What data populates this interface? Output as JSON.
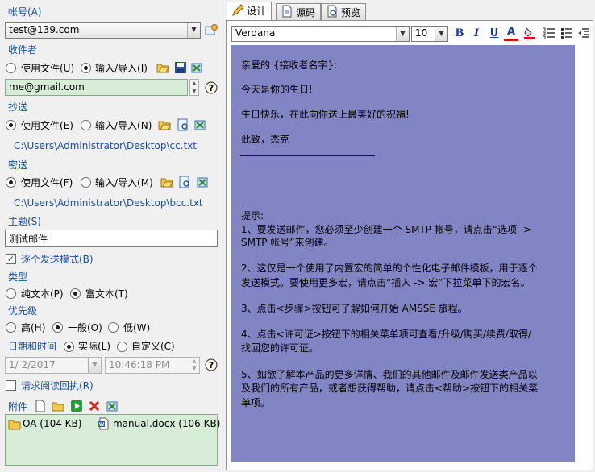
{
  "account": {
    "label": "帐号(A)",
    "value": "test@139.com"
  },
  "recipients": {
    "label": "收件者",
    "opt_file": "使用文件(U)",
    "opt_input": "输入/导入(I)",
    "value": "me@gmail.com"
  },
  "cc": {
    "label": "抄送",
    "opt_file": "使用文件(E)",
    "opt_input": "输入/导入(N)",
    "path": "C:\\Users\\Administrator\\Desktop\\cc.txt"
  },
  "bcc": {
    "label": "密送",
    "opt_file": "使用文件(F)",
    "opt_input": "输入/导入(M)",
    "path": "C:\\Users\\Administrator\\Desktop\\bcc.txt"
  },
  "subject": {
    "label": "主题(S)",
    "value": "测试邮件"
  },
  "one_by_one": "逐个发送模式(B)",
  "type": {
    "label": "类型",
    "opt_plain": "纯文本(P)",
    "opt_rich": "富文本(T)"
  },
  "priority": {
    "label": "优先级",
    "opt_high": "高(H)",
    "opt_normal": "一般(O)",
    "opt_low": "低(W)"
  },
  "datetime": {
    "label": "日期和时间",
    "opt_actual": "实际(L)",
    "opt_custom": "自定义(C)",
    "date": "1/  2/2017",
    "time": "10:46:18 PM"
  },
  "read_receipt": "请求阅读回执(R)",
  "attachments": {
    "label": "附件",
    "items": [
      {
        "name": "OA (104 KB)",
        "icon": "folder-icon"
      },
      {
        "name": "manual.docx (106 KB)",
        "icon": "word-doc-icon"
      }
    ]
  },
  "tabs": [
    {
      "label": "设计",
      "icon": "design-icon"
    },
    {
      "label": "源码",
      "icon": "source-icon"
    },
    {
      "label": "预览",
      "icon": "preview-icon"
    }
  ],
  "toolbar": {
    "font": "Verdana",
    "size": "10",
    "bold": "B",
    "italic": "I",
    "underline": "U",
    "font_color": "A"
  },
  "editor": {
    "greeting": "亲爱的 {接收者名字}:",
    "line1": "今天是你的生日!",
    "line2": "生日快乐，在此向你送上最美好的祝福!",
    "sign": "此致，杰克",
    "hint_title": "提示:",
    "hint1a": "1、要发送邮件，您必须至少创建一个  SMTP 帐号，请点击“选项 ->",
    "hint1b": "SMTP 帐号”来创建。",
    "hint2a": "2、这仅是一个使用了内置宏的简单的个性化电子邮件模板，用于逐个",
    "hint2b": "发送模式。要使用更多宏，请点击“插入 -> 宏”下拉菜单下的宏名。",
    "hint3": "3、点击<步骤>按钮可了解如何开始  AMSSE 旅程。",
    "hint4a": "4、点击<许可证>按钮下的相关菜单项可查看/升级/购买/续费/取得/",
    "hint4b": "找回您的许可证。",
    "hint5a": "5、如欲了解本产品的更多详情、我们的其他邮件及邮件发送类产品以",
    "hint5b": "及我们的所有产品，或者想获得帮助，请点击<帮助>按钮下的相关菜",
    "hint5c": "单项。"
  },
  "colors": {
    "editor_bg": "#8285c3",
    "label_blue": "#1a4fa0",
    "green_field": "#d8edd8"
  }
}
